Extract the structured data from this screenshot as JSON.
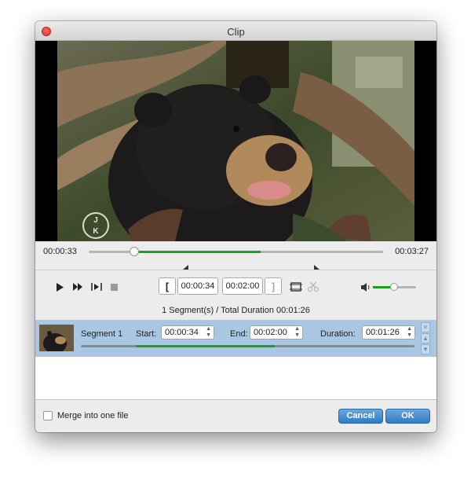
{
  "window": {
    "title": "Clip"
  },
  "video": {
    "watermark_top": "J",
    "watermark_bottom": "K"
  },
  "seek": {
    "current_time": "00:00:33",
    "total_time": "00:03:27",
    "progress": 0.16
  },
  "controls": {
    "icons": [
      "play-icon",
      "fast-forward-icon",
      "step-icon",
      "stop-icon",
      "set-start-icon",
      "set-end-icon",
      "crop-icon",
      "cut-icon",
      "volume-icon"
    ],
    "start_label": "[",
    "start_time": "00:00:34",
    "end_time": "00:02:00",
    "end_label": "]",
    "volume": 0.45
  },
  "summary": "1 Segment(s) / Total Duration 00:01:26",
  "segments": [
    {
      "name": "Segment 1",
      "start_label": "Start:",
      "start": "00:00:34",
      "end_label": "End:",
      "end": "00:02:00",
      "duration_label": "Duration:",
      "duration": "00:01:26"
    }
  ],
  "footer": {
    "merge_label": "Merge into one file",
    "merge_checked": false,
    "cancel_label": "Cancel",
    "ok_label": "OK"
  },
  "colors": {
    "accent_green": "#1aa31a",
    "selection_blue": "#a9c6e2",
    "button_blue": "#2f7bc4"
  }
}
